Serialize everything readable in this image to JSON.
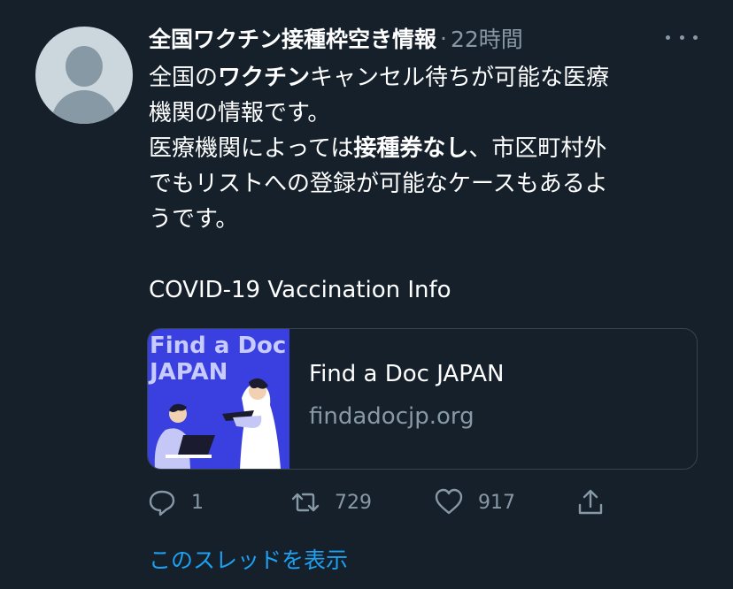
{
  "tweet": {
    "display_name": "全国ワクチン接種枠空き情報",
    "separator": "·",
    "timestamp": "22時間",
    "text_lines": [
      [
        {
          "t": "全国の",
          "b": false
        },
        {
          "t": "ワクチン",
          "b": true
        },
        {
          "t": "キャンセル待ちが可能な医療",
          "b": false
        }
      ],
      [
        {
          "t": "機関の情報です。",
          "b": false
        }
      ],
      [
        {
          "t": "医療機関によっては",
          "b": false
        },
        {
          "t": "接種券なし",
          "b": true
        },
        {
          "t": "、市区町村外",
          "b": false
        }
      ],
      [
        {
          "t": "でもリストへの登録が可能なケースもあるよ",
          "b": false
        }
      ],
      [
        {
          "t": "うです。",
          "b": false
        }
      ],
      [
        {
          "t": "",
          "b": false
        }
      ],
      [
        {
          "t": "COVID-19 Vaccination Info",
          "b": false
        }
      ]
    ]
  },
  "card": {
    "image_title_line1": "Find a Doc",
    "image_title_line2": "JAPAN",
    "title": "Find a Doc JAPAN",
    "domain": "findadocjp.org"
  },
  "actions": {
    "reply_count": "1",
    "retweet_count": "729",
    "like_count": "917"
  },
  "show_thread": "このスレッドを表示",
  "colors": {
    "background": "#15202b",
    "secondary": "#8899a6",
    "link": "#1da1f2",
    "card_image_bg": "#3a3fe0"
  },
  "icons": [
    "avatar-placeholder-icon",
    "more-icon",
    "reply-icon",
    "retweet-icon",
    "like-icon",
    "share-icon"
  ]
}
